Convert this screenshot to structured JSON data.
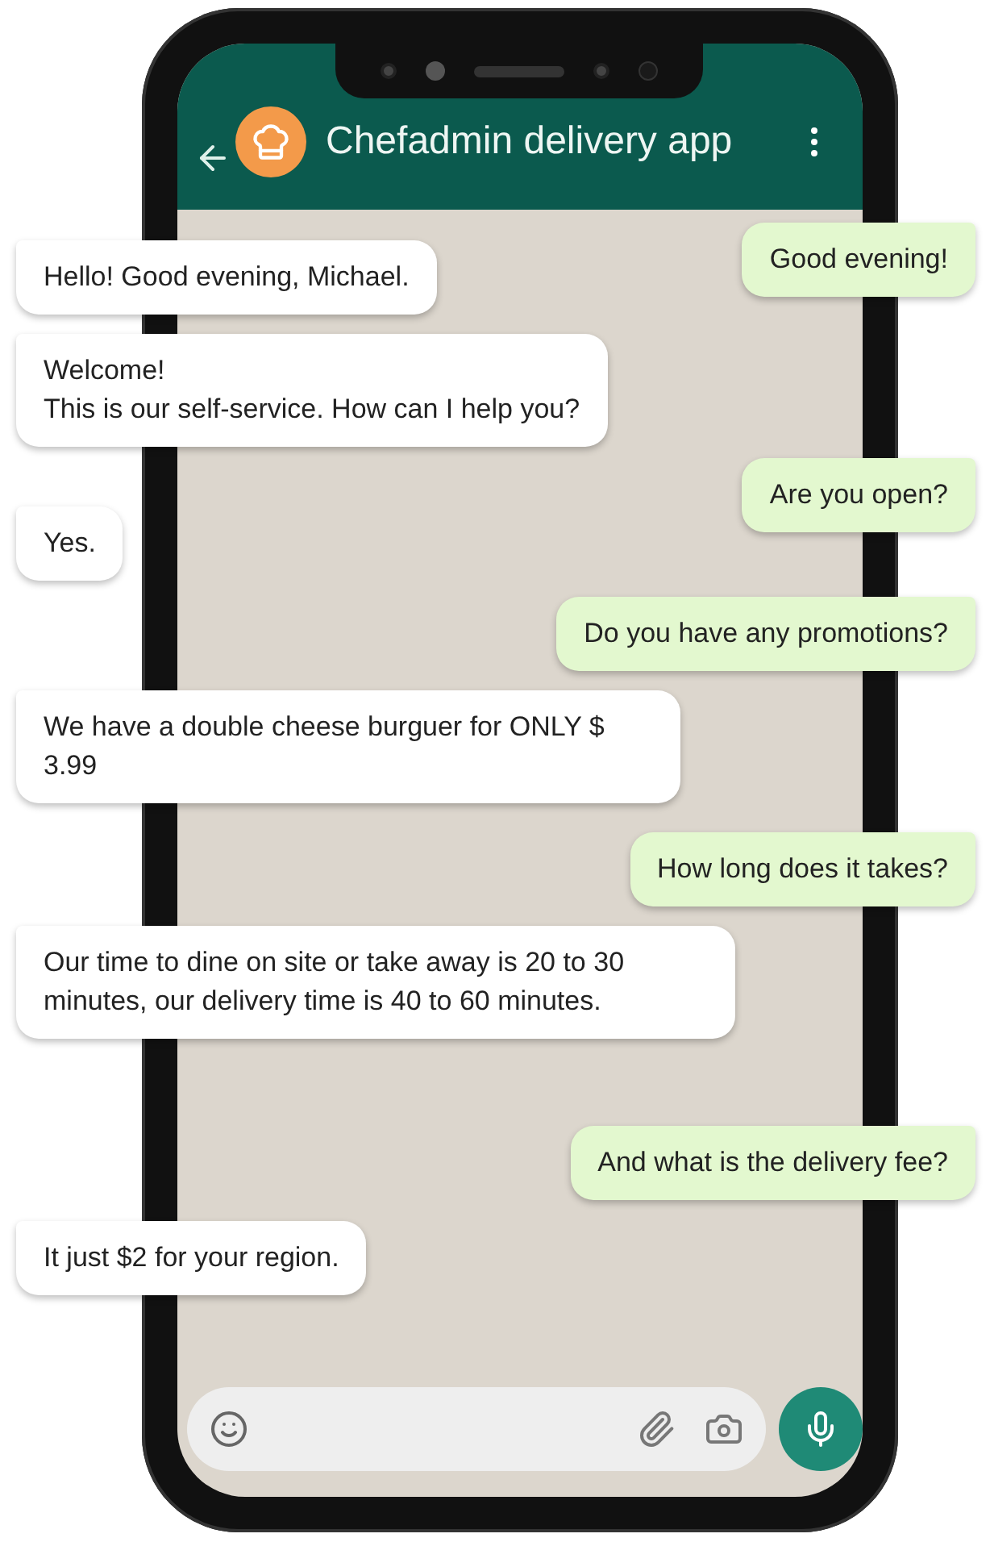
{
  "header": {
    "title": "Chefadmin delivery app"
  },
  "messages": [
    {
      "kind": "sent",
      "text": "Good evening!"
    },
    {
      "kind": "received",
      "text": "Hello! Good evening, Michael."
    },
    {
      "kind": "received",
      "text": "Welcome!\nThis is our self-service. How can I help you?"
    },
    {
      "kind": "sent",
      "text": "Are you open?"
    },
    {
      "kind": "received",
      "text": "Yes."
    },
    {
      "kind": "sent",
      "text": "Do you have any promotions?"
    },
    {
      "kind": "received",
      "text": "We have a double cheese burguer for ONLY $ 3.99"
    },
    {
      "kind": "sent",
      "text": "How long does it takes?"
    },
    {
      "kind": "received",
      "text": "Our time to dine on site or take away is 20 to 30 minutes, our delivery time is 40 to 60 minutes."
    },
    {
      "kind": "sent",
      "text": "And what is the delivery fee?"
    },
    {
      "kind": "received",
      "text": "It just $2 for your region."
    }
  ]
}
